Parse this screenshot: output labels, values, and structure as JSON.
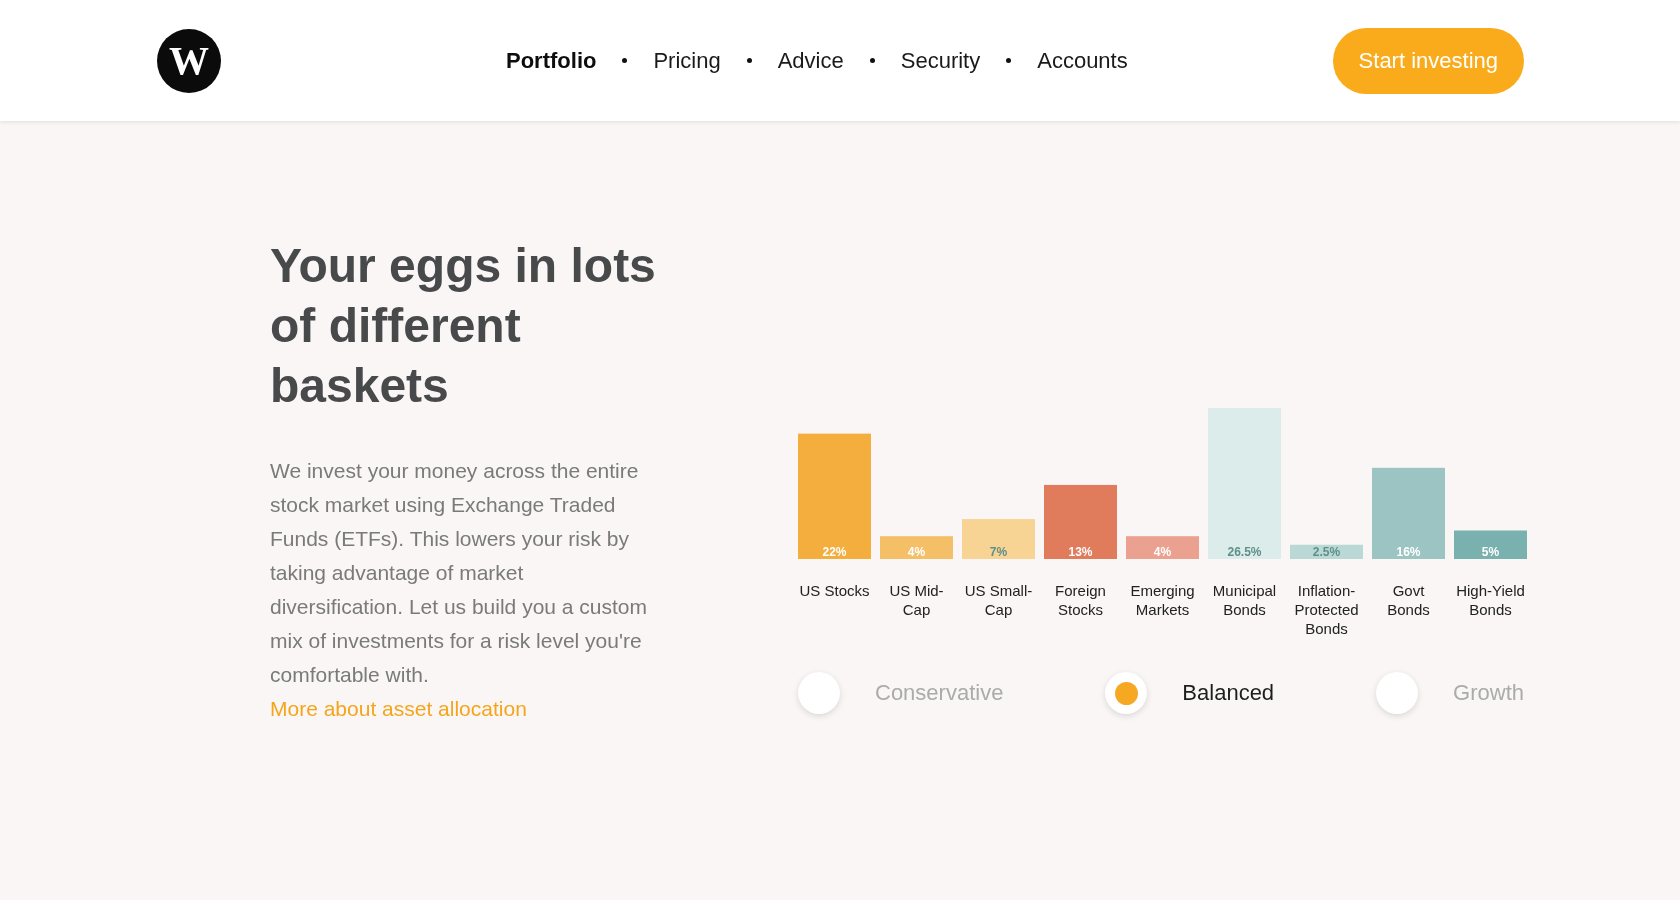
{
  "header": {
    "logo": "W",
    "nav": [
      {
        "label": "Portfolio",
        "selected": true
      },
      {
        "label": "Pricing",
        "selected": false
      },
      {
        "label": "Advice",
        "selected": false
      },
      {
        "label": "Security",
        "selected": false
      },
      {
        "label": "Accounts",
        "selected": false
      }
    ],
    "cta": "Start investing"
  },
  "hero": {
    "title": "Your eggs in lots of different baskets",
    "body": "We invest your money across the entire stock market using Exchange Traded Funds (ETFs). This lowers your risk by taking advantage of market diversification. Let us build you a custom mix of investments for a risk level you're comfortable with.",
    "link": "More about asset allocation"
  },
  "allocation": {
    "chart_data": {
      "type": "bar",
      "categories": [
        "US Stocks",
        "US Mid-Cap",
        "US Small-Cap",
        "Foreign Stocks",
        "Emerging Markets",
        "Municipal Bonds",
        "Inflation-Protected Bonds",
        "Govt Bonds",
        "High-Yield Bonds"
      ],
      "values": [
        22,
        4,
        7,
        13,
        4,
        26.5,
        2.5,
        16,
        5
      ],
      "data_labels": true,
      "value_labels": [
        "22%",
        "4%",
        "7%",
        "13%",
        "4%",
        "26.5%",
        "2.5%",
        "16%",
        "5%"
      ],
      "colors": [
        "#f3ae3e",
        "#f4bf67",
        "#f7d394",
        "#e07b5c",
        "#eba18f",
        "#dcecea",
        "#bad8d6",
        "#9cc4c3",
        "#78b1ad"
      ]
    },
    "risk_levels": [
      {
        "label": "Conservative",
        "selected": false
      },
      {
        "label": "Balanced",
        "selected": true
      },
      {
        "label": "Growth",
        "selected": false
      }
    ]
  }
}
